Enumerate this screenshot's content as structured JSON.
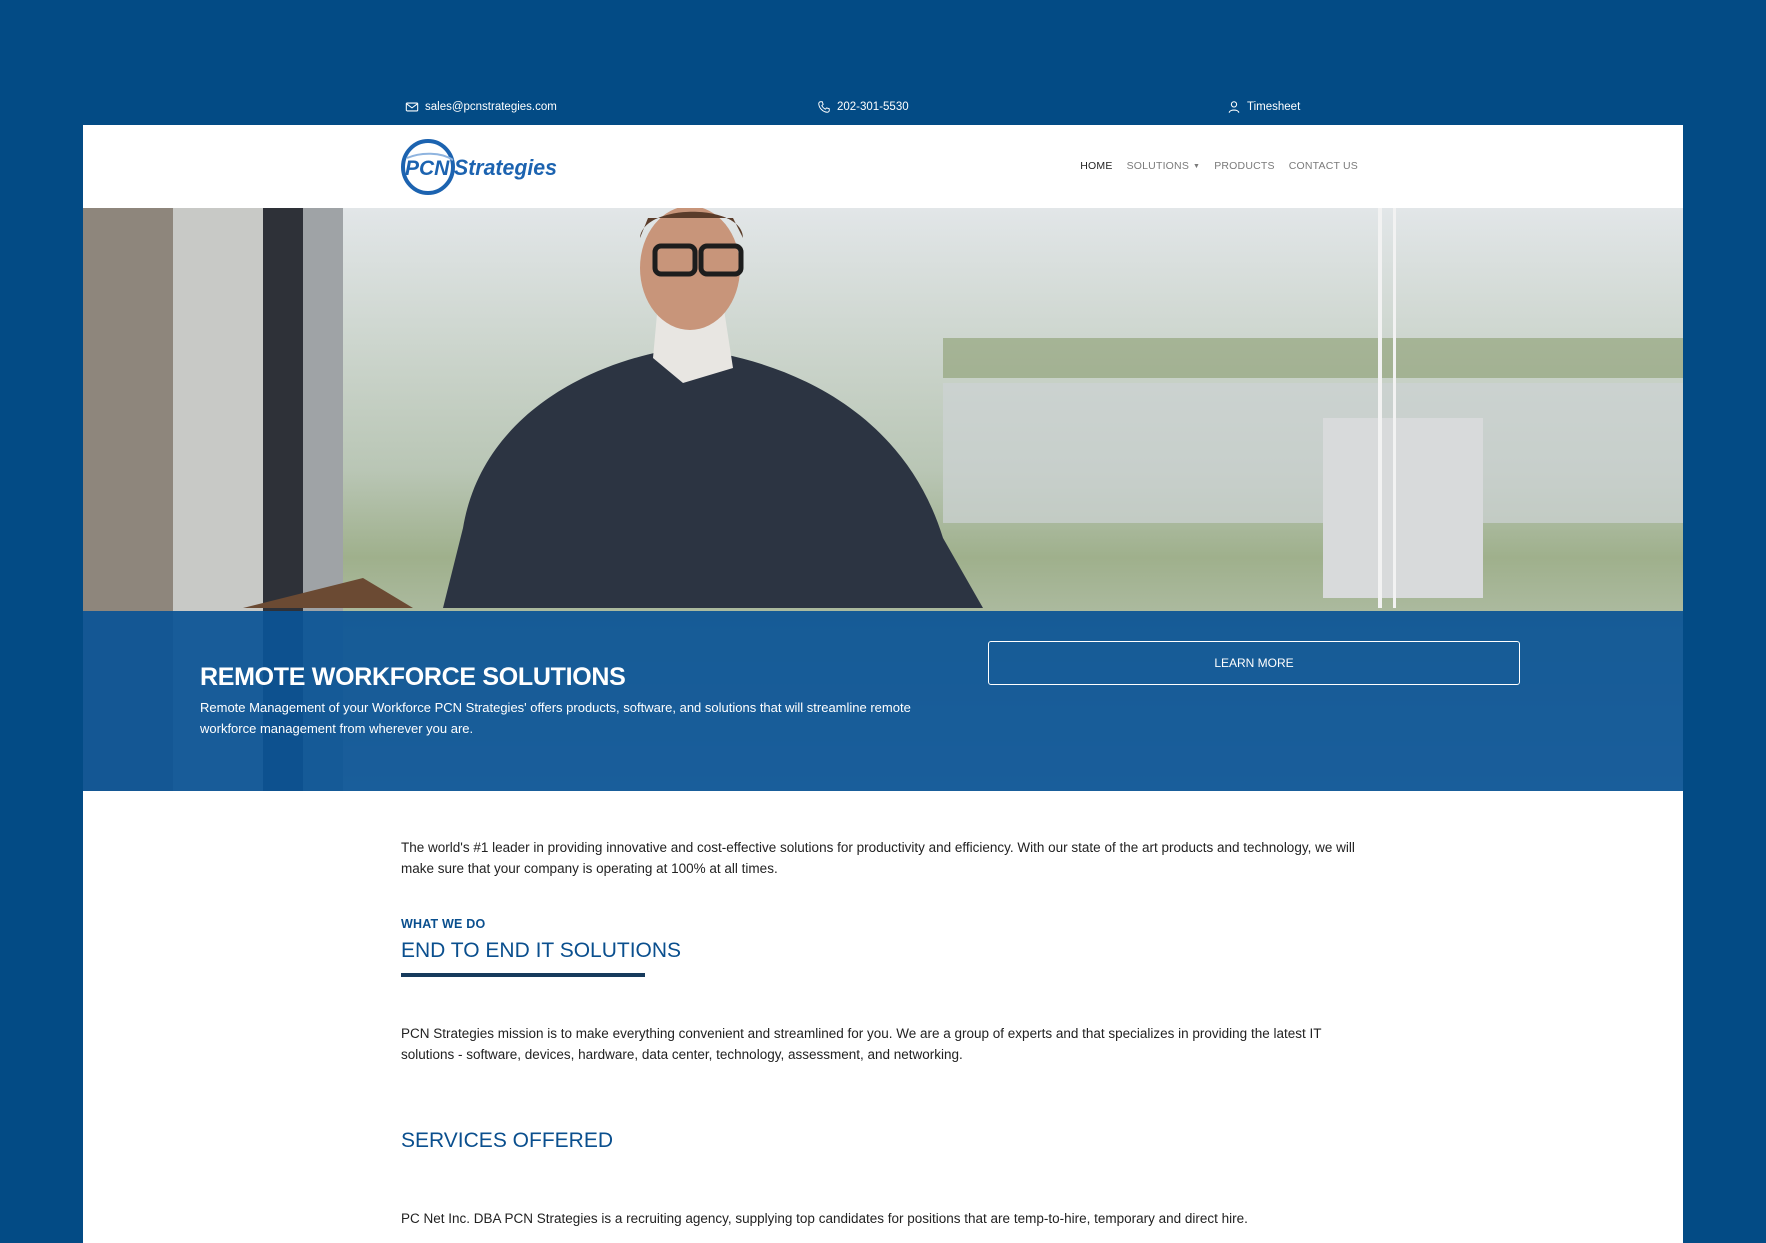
{
  "topbar": {
    "email": "sales@pcnstrategies.com",
    "phone": "202-301-5530",
    "timesheet": "Timesheet"
  },
  "brand": {
    "logo_text_left": "PCN",
    "logo_text_right": "Strategies",
    "color": "#1c63b0"
  },
  "nav": {
    "home": "HOME",
    "solutions": "SOLUTIONS",
    "products": "PRODUCTS",
    "contact": "CONTACT US"
  },
  "hero": {
    "title": "REMOTE WORKFORCE SOLUTIONS",
    "description": "Remote Management of your Workforce PCN Strategies' offers products, software, and solutions that will streamline remote workforce management from wherever you are.",
    "button": "LEARN MORE"
  },
  "content": {
    "intro": "The world's #1 leader in providing innovative and cost-effective solutions for productivity and efficiency. With our state of the art products and technology, we will make sure that your company is operating at 100% at all times.",
    "eyebrow": "WHAT WE DO",
    "heading1": "END TO END IT SOLUTIONS",
    "mission": "PCN Strategies mission is to make everything convenient and streamlined for you. We are a group of experts and that specializes in providing the latest IT solutions - software, devices, hardware, data center, technology, assessment, and networking.",
    "heading2": "SERVICES OFFERED",
    "services": "PC Net Inc. DBA PCN Strategies is a recruiting agency, supplying top candidates for positions that are temp-to-hire, temporary and direct hire."
  },
  "colors": {
    "page_bg": "#034b85",
    "band": "#0b5496",
    "heading": "#0a4f8e"
  }
}
